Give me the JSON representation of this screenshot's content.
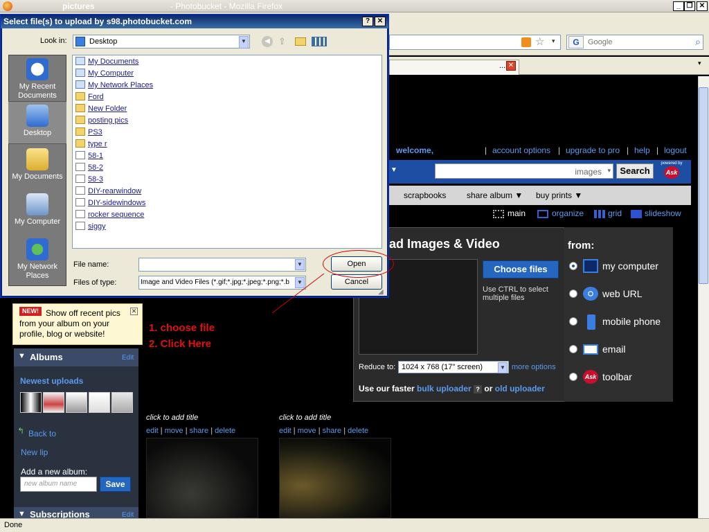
{
  "browser": {
    "title_part1": "pictures",
    "title_part2": "- Photobucket - Mozilla Firefox",
    "search_placeholder": "Google",
    "status": "Done"
  },
  "page": {
    "welcome": "welcome,",
    "top_links": [
      "account options",
      "upgrade to pro",
      "help",
      "logout"
    ],
    "search_placeholder": "images",
    "search_button": "Search",
    "powered_by": "powered by",
    "subnav": [
      "scrapbooks",
      "share album ▼",
      "buy prints ▼"
    ],
    "views": [
      "main",
      "organize",
      "grid",
      "slideshow"
    ],
    "upload_title": "ad Images & Video",
    "choose_files": "Choose files",
    "ctrl_hint": "Use CTRL to select multiple files",
    "reduce_label": "Reduce to:",
    "reduce_value": "1024 x 768 (17\" screen)",
    "more_options": "more options",
    "faster_prefix": "Use our faster",
    "bulk_uploader": "bulk uploader",
    "or": "or",
    "old_uploader": "old uploader",
    "from_label": "from:",
    "from_options": [
      "my computer",
      "web URL",
      "mobile phone",
      "email",
      "toolbar"
    ],
    "instructions": [
      "1. choose file",
      "2. Click Here"
    ],
    "new_tag": "NEW!",
    "new_text": "Show off recent pics from your album on your profile, blog or website!",
    "albums_title": "Albums",
    "edit": "Edit",
    "newest_uploads": "Newest uploads",
    "back_to": "Back to",
    "new_lip": "New lip",
    "add_album_label": "Add a new album:",
    "album_name_placeholder": "new album name",
    "save": "Save",
    "subscriptions": "Subscriptions",
    "photos": [
      {
        "caption": "click to add title",
        "actions": [
          "edit",
          "move",
          "share",
          "delete"
        ]
      },
      {
        "caption": "click to add title",
        "actions": [
          "edit",
          "move",
          "share",
          "delete"
        ]
      }
    ]
  },
  "dialog": {
    "title": "Select file(s) to upload by s98.photobucket.com",
    "look_in_label": "Look in:",
    "look_in_value": "Desktop",
    "places": [
      "My Recent Documents",
      "Desktop",
      "My Documents",
      "My Computer",
      "My Network Places"
    ],
    "files": [
      {
        "name": "My Documents",
        "kind": "sys"
      },
      {
        "name": "My Computer",
        "kind": "sys"
      },
      {
        "name": "My Network Places",
        "kind": "sys"
      },
      {
        "name": "Ford",
        "kind": "folder"
      },
      {
        "name": "New Folder",
        "kind": "folder"
      },
      {
        "name": "posting pics",
        "kind": "folder"
      },
      {
        "name": "PS3",
        "kind": "folder"
      },
      {
        "name": "type r",
        "kind": "folder"
      },
      {
        "name": "58-1",
        "kind": "img"
      },
      {
        "name": "58-2",
        "kind": "img"
      },
      {
        "name": "58-3",
        "kind": "img"
      },
      {
        "name": "DIY-rearwindow",
        "kind": "img"
      },
      {
        "name": "DIY-sidewindows",
        "kind": "img"
      },
      {
        "name": "rocker sequence",
        "kind": "img"
      },
      {
        "name": "siggy",
        "kind": "img"
      }
    ],
    "file_name_label": "File name:",
    "file_name_value": "",
    "file_type_label": "Files of type:",
    "file_type_value": "Image and Video Files (*.gif;*.jpg;*.jpeg;*.png;*.b",
    "open": "Open",
    "cancel": "Cancel"
  },
  "colors": {
    "accent": "#2466c0",
    "link": "#5b9bef",
    "annotation": "#e31010"
  }
}
